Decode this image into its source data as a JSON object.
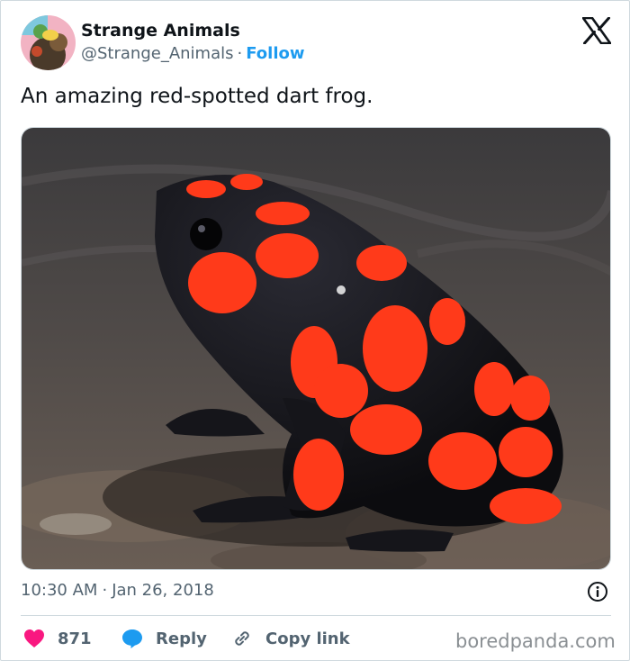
{
  "author": {
    "name": "Strange Animals",
    "handle": "@Strange_Animals",
    "separator": "·",
    "follow_label": "Follow"
  },
  "tweet": {
    "text": "An amazing red-spotted dart frog."
  },
  "meta": {
    "time": "10:30 AM",
    "separator": "·",
    "date": "Jan 26, 2018"
  },
  "actions": {
    "likes": "871",
    "reply_label": "Reply",
    "copy_label": "Copy link"
  },
  "watermark": "boredpanda.com",
  "colors": {
    "accent": "#1d9bf0",
    "like": "#f91880",
    "text": "#0f1419",
    "secondary": "#536471",
    "border": "#cfd9de",
    "frog_black": "#111114",
    "frog_orange": "#ff3a1a"
  },
  "icons": {
    "platform": "x-logo-icon",
    "info": "info-icon",
    "like": "heart-icon",
    "reply": "reply-bubble-icon",
    "copy": "link-icon"
  }
}
